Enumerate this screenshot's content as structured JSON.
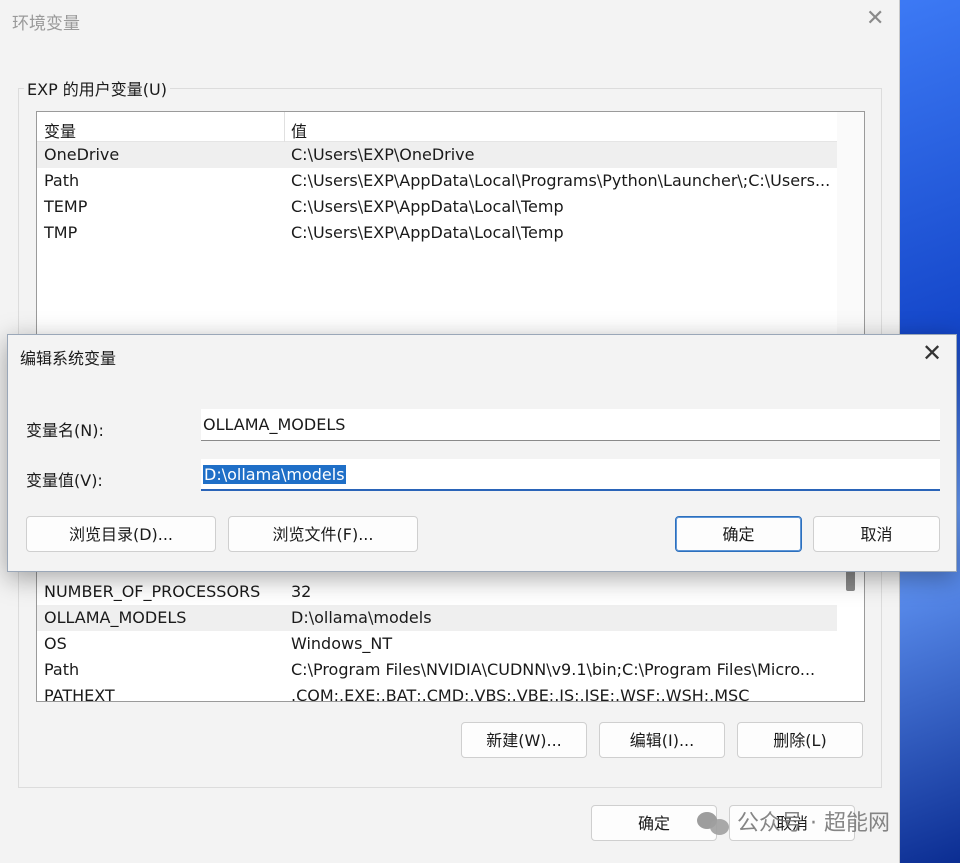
{
  "main_window": {
    "title": "环境变量",
    "user_group_label": "EXP 的用户变量(U)",
    "columns": {
      "name": "变量",
      "value": "值"
    },
    "user_vars": [
      {
        "name": "OneDrive",
        "value": "C:\\Users\\EXP\\OneDrive"
      },
      {
        "name": "Path",
        "value": "C:\\Users\\EXP\\AppData\\Local\\Programs\\Python\\Launcher\\;C:\\Users..."
      },
      {
        "name": "TEMP",
        "value": "C:\\Users\\EXP\\AppData\\Local\\Temp"
      },
      {
        "name": "TMP",
        "value": "C:\\Users\\EXP\\AppData\\Local\\Temp"
      }
    ],
    "system_vars": [
      {
        "name": "NUMBER_OF_PROCESSORS",
        "value": "32"
      },
      {
        "name": "OLLAMA_MODELS",
        "value": "D:\\ollama\\models"
      },
      {
        "name": "OS",
        "value": "Windows_NT"
      },
      {
        "name": "Path",
        "value": "C:\\Program Files\\NVIDIA\\CUDNN\\v9.1\\bin;C:\\Program Files\\Micro..."
      },
      {
        "name": "PATHEXT",
        "value": ".COM;.EXE;.BAT;.CMD;.VBS;.VBE;.JS;.JSE;.WSF;.WSH;.MSC"
      }
    ],
    "buttons": {
      "new": "新建(W)...",
      "edit": "编辑(I)...",
      "delete": "删除(L)",
      "ok": "确定",
      "cancel": "取消"
    }
  },
  "edit_dialog": {
    "title": "编辑系统变量",
    "name_label": "变量名(N):",
    "name_value": "OLLAMA_MODELS",
    "value_label": "变量值(V):",
    "value_value": "D:\\ollama\\models",
    "buttons": {
      "browse_dir": "浏览目录(D)...",
      "browse_file": "浏览文件(F)...",
      "ok": "确定",
      "cancel": "取消"
    }
  },
  "watermark": {
    "text": "公众号 · 超能网"
  }
}
